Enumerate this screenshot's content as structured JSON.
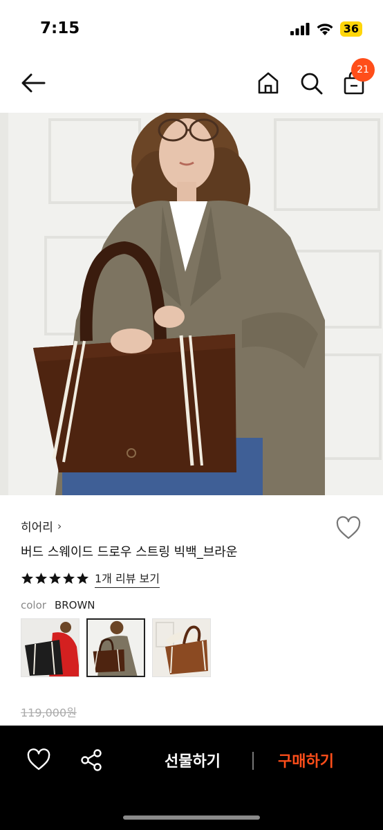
{
  "status": {
    "time": "7:15",
    "battery": "36"
  },
  "nav": {
    "cart_count": "21"
  },
  "product": {
    "brand": "히어리",
    "brand_chevron": "›",
    "name": "버드 스웨이드 드로우 스트링 빅백_브라운",
    "stars": 5,
    "review_link": "1개 리뷰 보기",
    "option_label": "color",
    "option_value": "BROWN",
    "original_price": "119,000원"
  },
  "thumbnails": [
    {
      "name": "black-red-variant",
      "selected": false
    },
    {
      "name": "brown-variant",
      "selected": true
    },
    {
      "name": "tan-variant",
      "selected": false
    }
  ],
  "bottom_bar": {
    "gift_label": "선물하기",
    "buy_label": "구매하기"
  },
  "colors": {
    "accent": "#ff4e1a",
    "bar_bg": "#000000"
  }
}
